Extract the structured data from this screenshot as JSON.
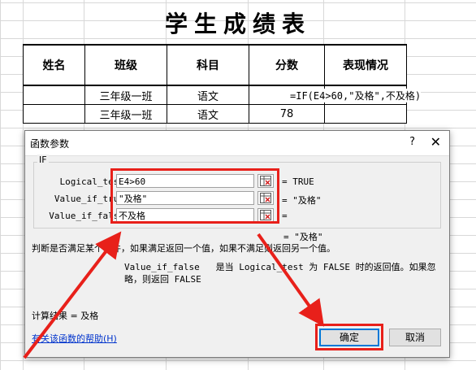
{
  "sheet": {
    "title": "学生成绩表",
    "headers": [
      "姓名",
      "班级",
      "科目",
      "分数",
      "表现情况"
    ],
    "rows": [
      {
        "name": "",
        "class": "三年级一班",
        "subject": "语文",
        "score": "",
        "performance": ""
      },
      {
        "name": "",
        "class": "三年级一班",
        "subject": "语文",
        "score": "78",
        "performance": ""
      }
    ],
    "formula": "=IF(E4>60,\"及格\",不及格)"
  },
  "dialog": {
    "title": "函数参数",
    "help_glyph": "?",
    "close_glyph": "✕",
    "function_name": "IF",
    "args": [
      {
        "label": "Logical_test",
        "value": "E4>60",
        "result": "= TRUE"
      },
      {
        "label": "Value_if_true",
        "value": "\"及格\"",
        "result": "= \"及格\""
      },
      {
        "label": "Value_if_false",
        "value": "不及格",
        "result": "="
      }
    ],
    "overall_result": "= \"及格\"",
    "description": "判断是否满足某个条件，如果满足返回一个值，如果不满足则返回另一个值。",
    "param_name": "Value_if_false",
    "param_description": "是当 Logical_test 为 FALSE 时的返回值。如果忽略，则返回 FALSE",
    "calc_result": "计算结果 = 及格",
    "help_link": "有关该函数的帮助(H)",
    "ok_label": "确定",
    "cancel_label": "取消"
  },
  "colors": {
    "highlight": "#e8201a",
    "link": "#0033cc"
  }
}
